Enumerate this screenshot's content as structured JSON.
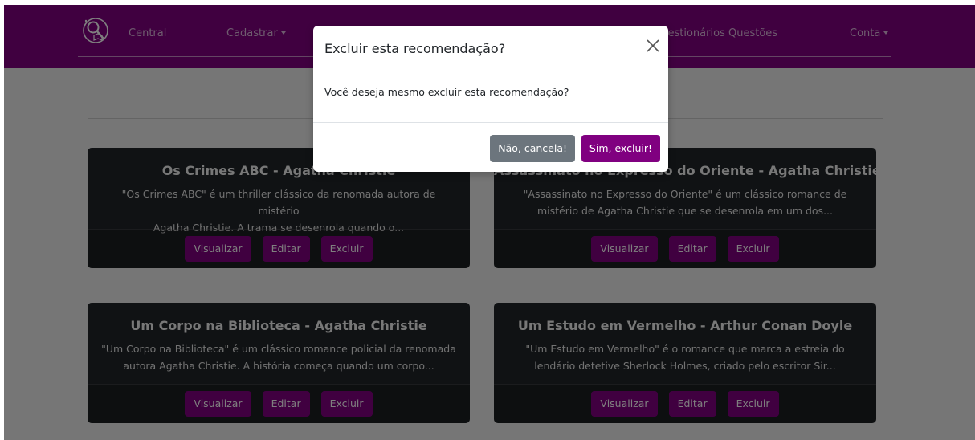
{
  "navbar": {
    "logo_icon": "magnifier-book-logo-icon",
    "links": {
      "central": "Central",
      "cadastrar": "Cadastrar",
      "questionarios": "Questionários",
      "questoes": "Questões",
      "conta": "Conta"
    }
  },
  "cards": [
    {
      "title": "Os Crimes ABC - Agatha Christie",
      "line1": "\"Os Crimes ABC\" é um thriller clássico da renomada autora de mistério",
      "line2": "Agatha Christie. A trama se desenrola quando o..."
    },
    {
      "title": "Assassinato no Expresso do Oriente - Agatha Christie",
      "line1": "\"Assassinato no Expresso do Oriente\" é um clássico romance de",
      "line2": "mistério de Agatha Christie que se desenrola em um dos..."
    },
    {
      "title": "Um Corpo na Biblioteca - Agatha Christie",
      "line1": "\"Um Corpo na Biblioteca\" é um clássico romance policial da renomada",
      "line2": "autora Agatha Christie. A história começa quando um corpo..."
    },
    {
      "title": "Um Estudo em Vermelho - Arthur Conan Doyle",
      "line1": "\"Um Estudo em Vermelho\" é o romance que marca a estreia do",
      "line2": "lendário detetive Sherlock Holmes, criado pelo escritor Sir..."
    }
  ],
  "card_buttons": {
    "view": "Visualizar",
    "edit": "Editar",
    "delete": "Excluir"
  },
  "modal": {
    "title": "Excluir esta recomendação?",
    "body": "Você deseja mesmo excluir esta recomendação?",
    "cancel": "Não, cancela!",
    "confirm": "Sim, excluir!"
  },
  "colors": {
    "brand": "#800080",
    "card_bg": "#212529",
    "secondary": "#6c757d"
  }
}
